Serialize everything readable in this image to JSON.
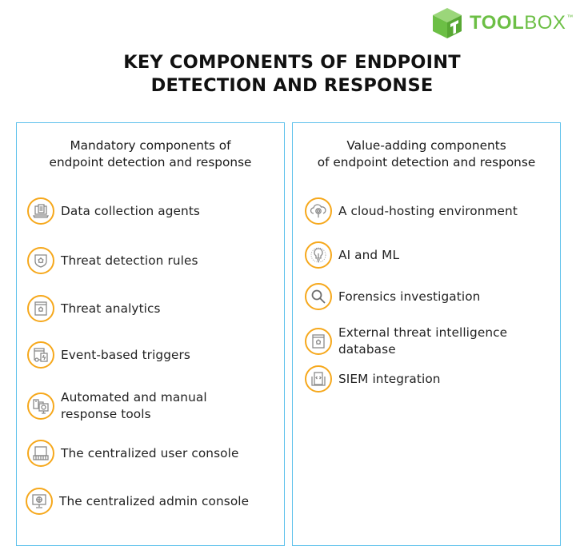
{
  "brand": {
    "name_bold": "TOOL",
    "name_light": "BOX",
    "trademark": "™",
    "color": "#6cbf45"
  },
  "title": {
    "line1": "KEY COMPONENTS OF ENDPOINT",
    "line2": "DETECTION AND RESPONSE"
  },
  "colors": {
    "box_border": "#5ec1ec",
    "icon_ring": "#f6a81c",
    "icon_glyph": "#8a8a8a"
  },
  "mandatory": {
    "heading_line1": "Mandatory components of",
    "heading_line2": "endpoint detection and response",
    "items": [
      {
        "icon": "document-laptop-icon",
        "line1": "Data collection agents",
        "line2": ""
      },
      {
        "icon": "shield-bug-icon",
        "line1": "Threat detection rules",
        "line2": ""
      },
      {
        "icon": "browser-bug-icon",
        "line1": "Threat analytics",
        "line2": ""
      },
      {
        "icon": "trigger-devices-icon",
        "line1": "Event-based triggers",
        "line2": ""
      },
      {
        "icon": "phone-monitor-icon",
        "line1": "Automated and manual",
        "line2": "response tools"
      },
      {
        "icon": "laptop-keyboard-icon",
        "line1": "The centralized user console",
        "line2": ""
      },
      {
        "icon": "monitor-target-icon",
        "line1": "The centralized admin console",
        "line2": ""
      }
    ]
  },
  "value_adding": {
    "heading_line1": "Value-adding components",
    "heading_line2": "of endpoint detection and response",
    "items": [
      {
        "icon": "cloud-search-icon",
        "line1": "A cloud-hosting environment",
        "line2": ""
      },
      {
        "icon": "lightbulb-icon",
        "line1": "AI and ML",
        "line2": ""
      },
      {
        "icon": "magnifier-icon",
        "line1": "Forensics investigation",
        "line2": ""
      },
      {
        "icon": "browser-bug-icon",
        "line1": "External threat intelligence",
        "line2": "database"
      },
      {
        "icon": "code-document-icon",
        "line1": "SIEM integration",
        "line2": ""
      }
    ]
  }
}
